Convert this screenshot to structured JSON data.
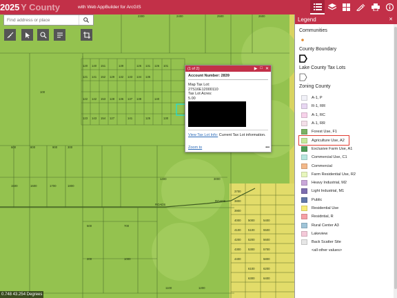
{
  "header": {
    "title": "2025",
    "title_faint": "Y County",
    "subtitle": "with Web AppBuilder for ArcGIS",
    "icons": [
      "legend-list-icon",
      "layers-icon",
      "basemap-gallery-icon",
      "draw-icon",
      "print-icon",
      "about-icon"
    ]
  },
  "search": {
    "placeholder": "Find address or place"
  },
  "map_tools": [
    "measure-tool",
    "select-tool",
    "find-tool",
    "coordinate-tool",
    "crop-tool"
  ],
  "map": {
    "scale_readout": "0.748 43.254 Degrees",
    "parcel_labels": [
      "120",
      "140",
      "151",
      "130",
      "139",
      "131",
      "126",
      "101",
      "103",
      "105",
      "121",
      "141",
      "152",
      "129",
      "132",
      "133",
      "134",
      "135",
      "102",
      "104",
      "122",
      "142",
      "153",
      "128",
      "136",
      "137",
      "138",
      "139",
      "140",
      "141",
      "123",
      "143",
      "154",
      "127",
      "100",
      "1600",
      "1800",
      "1900",
      "1000",
      "300",
      "400",
      "500",
      "600",
      "700",
      "800",
      "900",
      "1500",
      "1700",
      "200",
      "1000",
      "1100",
      "1200",
      "1300",
      "1400",
      "3700",
      "3800",
      "3900",
      "4000",
      "4100",
      "4200",
      "4300",
      "4400",
      "5000",
      "5100",
      "5200",
      "5300",
      "5400",
      "5500",
      "5600",
      "5700",
      "5800",
      "2400",
      "2500",
      "2600",
      "2700"
    ],
    "road_labels": [
      "ROADS",
      "ROADS"
    ]
  },
  "popup": {
    "page": "(1 of 2)",
    "title": "Account Number: 2839",
    "lines": [
      "Map Tax Lot:",
      "27S16E12000110",
      "Tax Lot Acres:",
      "5.00"
    ],
    "link_text": "View Tax Lot Info:",
    "link_suffix": "Current Tax Lot information.",
    "zoom_to": "Zoom to",
    "more": "•••"
  },
  "legend": {
    "header": "Legend",
    "layers": [
      {
        "title": "Communities"
      },
      {
        "title": "County Boundary"
      },
      {
        "title": "Lake County Tax Lots"
      },
      {
        "title": "Zoning County"
      }
    ],
    "zoning_items": [
      {
        "label": "A-1, P",
        "color": "#f1f1f8"
      },
      {
        "label": "R-1, RR",
        "color": "#e8d7f2"
      },
      {
        "label": "A-1, RC",
        "color": "#f7d2ea"
      },
      {
        "label": "A-1, RR",
        "color": "#f3dfe8"
      },
      {
        "label": "Forest Use, F1",
        "color": "#7ab163"
      },
      {
        "label": "Agriculture Use, A2",
        "color": "#c8e89a"
      },
      {
        "label": "Exclusive Farm Use, A1",
        "color": "#4e9c55"
      },
      {
        "label": "Commercial Use, C1",
        "color": "#b7e7de"
      },
      {
        "label": "Commercial",
        "color": "#f3b88a"
      },
      {
        "label": "Farm Residential Use, R2",
        "color": "#e7f6bd"
      },
      {
        "label": "Heavy Industrial, M2",
        "color": "#c9a7d9"
      },
      {
        "label": "Light Industrial, M1",
        "color": "#7d6db0"
      },
      {
        "label": "Public",
        "color": "#6278a8"
      },
      {
        "label": "Residential Use",
        "color": "#f7ec74"
      },
      {
        "label": "Residntial, R",
        "color": "#f6a0a6"
      },
      {
        "label": "Rural Center A3",
        "color": "#9fc4d8"
      },
      {
        "label": "Lakeview",
        "color": "#f4c9d9"
      },
      {
        "label": "Back Scatter Site",
        "color": "#e6e6e6"
      }
    ],
    "more_label": "<all other values>",
    "highlight_index": 5
  },
  "colors": {
    "brand": "#c23048",
    "map_green": "#94c24f",
    "parcel_line": "#4d6f2a",
    "highlight": "#e03a2f"
  }
}
